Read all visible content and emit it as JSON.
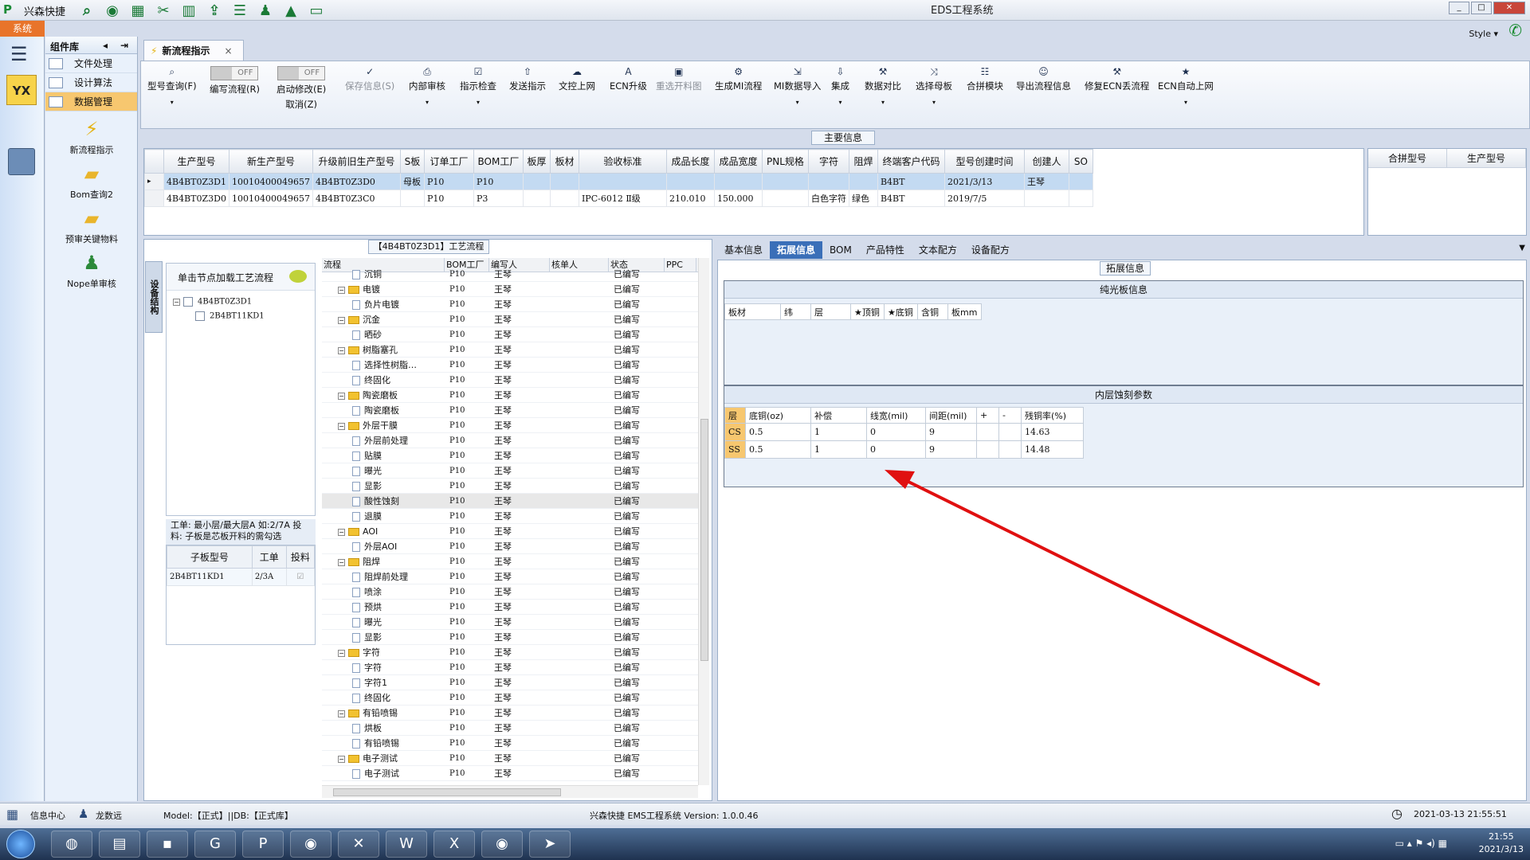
{
  "titlebar": {
    "quick_title": "兴森快捷",
    "app_title": "EDS工程系统",
    "min": "_",
    "max": "□",
    "close": "✕"
  },
  "system_tab": "系统",
  "style_label": "Style ▾",
  "component_lib": {
    "title": "组件库",
    "items": [
      {
        "label": "文件处理"
      },
      {
        "label": "设计算法"
      },
      {
        "label": "数据管理"
      }
    ],
    "tools": [
      {
        "label": "新流程指示"
      },
      {
        "label": "Bom查询2"
      },
      {
        "label": "预审关键物料"
      },
      {
        "label": "Nope单审核"
      }
    ]
  },
  "doc_tab": {
    "label": "新流程指示",
    "close": "×"
  },
  "ribbon": {
    "buttons": [
      {
        "label": "型号查询(F)"
      },
      {
        "label": "编写流程(R)"
      },
      {
        "label": "启动修改(E)",
        "sub": "取消(Z)"
      },
      {
        "label": "保存信息(S)"
      },
      {
        "label": "内部审核"
      },
      {
        "label": "指示检查"
      },
      {
        "label": "发送指示"
      },
      {
        "label": "文控上网"
      },
      {
        "label": "ECN升级"
      },
      {
        "label": "重选开料图"
      },
      {
        "label": "生成MI流程"
      },
      {
        "label": "MI数据导入"
      },
      {
        "label": "集成"
      },
      {
        "label": "数据对比"
      },
      {
        "label": "选择母板"
      },
      {
        "label": "合拼模块"
      },
      {
        "label": "导出流程信息"
      },
      {
        "label": "修复ECN丢流程"
      },
      {
        "label": "ECN自动上网"
      }
    ],
    "toggle_off": "OFF"
  },
  "main_info": {
    "title": "主要信息",
    "columns": [
      "生产型号",
      "新生产型号",
      "升级前旧生产型号",
      "S板",
      "订单工厂",
      "BOM工厂",
      "板厚",
      "板材",
      "验收标准",
      "成品长度",
      "成品宽度",
      "PNL规格",
      "字符",
      "阻焊",
      "终端客户代码",
      "型号创建时间",
      "创建人",
      "SO"
    ],
    "rows": [
      [
        "4B4BT0Z3D1",
        "10010400049657",
        "4B4BT0Z3D0",
        "母板",
        "P10",
        "P10",
        "",
        "",
        "",
        "",
        "",
        "",
        "",
        "",
        "B4BT",
        "2021/3/13",
        "王琴",
        ""
      ],
      [
        "4B4BT0Z3D0",
        "10010400049657",
        "4B4BT0Z3C0",
        "",
        "P10",
        "P3",
        "",
        "",
        "IPC-6012 Ⅱ级",
        "210.010",
        "150.000",
        "",
        "白色字符",
        "绿色",
        "B4BT",
        "2019/7/5",
        "",
        ""
      ]
    ],
    "side_columns": [
      "合拼型号",
      "生产型号"
    ]
  },
  "process": {
    "title": "【4B4BT0Z3D1】工艺流程",
    "vertical_tab": "设备结构",
    "hint": "单击节点加载工艺流程",
    "tree": [
      "4B4BT0Z3D1",
      "2B4BT11KD1"
    ],
    "note": "工单: 最小层/最大层A 如:2/7A 投料: 子板是芯板开料的需勾选",
    "sub_columns": [
      "子板型号",
      "工单",
      "投料"
    ],
    "sub_rows": [
      [
        "2B4BT11KD1",
        "2/3A",
        "☑"
      ]
    ],
    "grid_columns": [
      "流程",
      "BOM工厂",
      "编写人",
      "核单人",
      "状态",
      "PPC"
    ],
    "rows": [
      {
        "name": "沉铜",
        "lvl": 2,
        "type": "doc"
      },
      {
        "name": "电镀",
        "lvl": 1,
        "type": "folder"
      },
      {
        "name": "负片电镀",
        "lvl": 2,
        "type": "doc"
      },
      {
        "name": "沉金",
        "lvl": 1,
        "type": "folder"
      },
      {
        "name": "晒砂",
        "lvl": 2,
        "type": "doc"
      },
      {
        "name": "树脂塞孔",
        "lvl": 1,
        "type": "folder"
      },
      {
        "name": "选择性树脂…",
        "lvl": 2,
        "type": "doc"
      },
      {
        "name": "终固化",
        "lvl": 2,
        "type": "doc"
      },
      {
        "name": "陶瓷磨板",
        "lvl": 1,
        "type": "folder"
      },
      {
        "name": "陶瓷磨板",
        "lvl": 2,
        "type": "doc"
      },
      {
        "name": "外层干膜",
        "lvl": 1,
        "type": "folder"
      },
      {
        "name": "外层前处理",
        "lvl": 2,
        "type": "doc"
      },
      {
        "name": "贴膜",
        "lvl": 2,
        "type": "doc"
      },
      {
        "name": "曝光",
        "lvl": 2,
        "type": "doc"
      },
      {
        "name": "显影",
        "lvl": 2,
        "type": "doc"
      },
      {
        "name": "酸性蚀刻",
        "lvl": 2,
        "type": "doc",
        "hl": true
      },
      {
        "name": "退膜",
        "lvl": 2,
        "type": "doc"
      },
      {
        "name": "AOI",
        "lvl": 1,
        "type": "folder"
      },
      {
        "name": "外层AOI",
        "lvl": 2,
        "type": "doc"
      },
      {
        "name": "阻焊",
        "lvl": 1,
        "type": "folder"
      },
      {
        "name": "阻焊前处理",
        "lvl": 2,
        "type": "doc"
      },
      {
        "name": "喷涂",
        "lvl": 2,
        "type": "doc"
      },
      {
        "name": "预烘",
        "lvl": 2,
        "type": "doc"
      },
      {
        "name": "曝光",
        "lvl": 2,
        "type": "doc"
      },
      {
        "name": "显影",
        "lvl": 2,
        "type": "doc"
      },
      {
        "name": "字符",
        "lvl": 1,
        "type": "folder"
      },
      {
        "name": "字符",
        "lvl": 2,
        "type": "doc"
      },
      {
        "name": "字符1",
        "lvl": 2,
        "type": "doc"
      },
      {
        "name": "终固化",
        "lvl": 2,
        "type": "doc"
      },
      {
        "name": "有铅喷锡",
        "lvl": 1,
        "type": "folder"
      },
      {
        "name": "烘板",
        "lvl": 2,
        "type": "doc"
      },
      {
        "name": "有铅喷锡",
        "lvl": 2,
        "type": "doc"
      },
      {
        "name": "电子测试",
        "lvl": 1,
        "type": "folder"
      },
      {
        "name": "电子测试",
        "lvl": 2,
        "type": "doc"
      }
    ],
    "row_bom": "P10",
    "row_writer": "王琴",
    "row_status": "已编写"
  },
  "right_tabs": [
    "基本信息",
    "拓展信息",
    "BOM",
    "产品特性",
    "文本配方",
    "设备配方"
  ],
  "ext_info": {
    "title": "拓展信息",
    "sec1_title": "纯光板信息",
    "sec1_columns": [
      "板材",
      "纬",
      "层",
      "★顶铜",
      "★底铜",
      "含铜",
      "板mm"
    ],
    "sec2_title": "内层蚀刻参数",
    "sec2_columns": [
      "层",
      "底铜(oz)",
      "补偿",
      "线宽(mil)",
      "间距(mil)",
      "+",
      "-",
      "残铜率(%)"
    ],
    "sec2_rows": [
      [
        "CS",
        "0.5",
        "1",
        "0",
        "9",
        "",
        "",
        "14.63"
      ],
      [
        "SS",
        "0.5",
        "1",
        "0",
        "9",
        "",
        "",
        "14.48"
      ]
    ]
  },
  "statusbar": {
    "info_center": "信息中心",
    "user": "龙数远",
    "model": "Model:【正式】||DB:【正式库】",
    "version": "兴森快捷 EMS工程系统 Version: 1.0.0.46",
    "datetime": "2021-03-13 21:55:51"
  },
  "taskbar": {
    "time": "21:55",
    "date": "2021/3/13"
  },
  "colors": {
    "accent": "#3a6fb8",
    "selected_row": "#c3daf2",
    "highlight_orange": "#f7c76f",
    "annotation_arrow": "#e01010"
  }
}
